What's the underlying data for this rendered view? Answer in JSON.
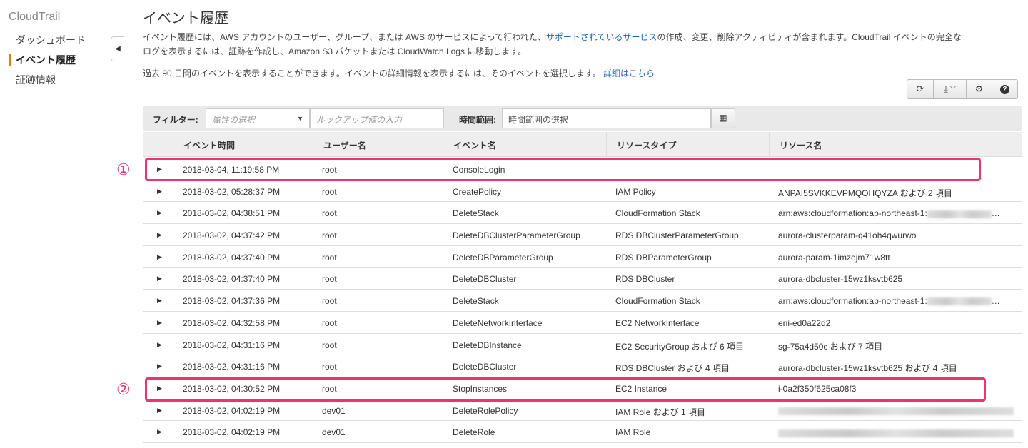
{
  "sidebar": {
    "brand": "CloudTrail",
    "items": [
      {
        "label": "ダッシュボード"
      },
      {
        "label": "イベント履歴"
      },
      {
        "label": "証跡情報"
      }
    ]
  },
  "main": {
    "title": "イベント履歴",
    "desc1_a": "イベント履歴には、AWS アカウントのユーザー、グループ、または AWS のサービスによって行われた、",
    "desc1_link": "サポートされているサービス",
    "desc1_b": "の作成、変更、削除アクティビティが含まれます。CloudTrail イベントの完全な",
    "desc2": "ログを表示するには、証跡を作成し、Amazon S3 バケットまたは CloudWatch Logs に移動します。",
    "desc3": "過去 90 日間のイベントを表示することができます。イベントの詳細情報を表示するには、そのイベントを選択します。",
    "desc3_link": "詳細はこちら"
  },
  "filter": {
    "label": "フィルター:",
    "attr_placeholder": "属性の選択",
    "lookup_placeholder": "ルックアップ値の入力",
    "time_label": "時間範囲:",
    "time_placeholder": "時間範囲の選択"
  },
  "table": {
    "headers": [
      "イベント時間",
      "ユーザー名",
      "イベント名",
      "リソースタイプ",
      "リソース名"
    ],
    "rows": [
      [
        "2018-03-04, 11:19:58 PM",
        "root",
        "ConsoleLogin",
        "",
        ""
      ],
      [
        "2018-03-02, 05:28:37 PM",
        "root",
        "CreatePolicy",
        "IAM Policy",
        "ANPAI5SVKKEVPMQOHQYZA および 2 項目"
      ],
      [
        "2018-03-02, 04:38:51 PM",
        "root",
        "DeleteStack",
        "CloudFormation Stack",
        "arn:aws:cloudformation:ap-northeast-1:"
      ],
      [
        "2018-03-02, 04:37:42 PM",
        "root",
        "DeleteDBClusterParameterGroup",
        "RDS DBClusterParameterGroup",
        "aurora-clusterparam-q41oh4qwurwo"
      ],
      [
        "2018-03-02, 04:37:40 PM",
        "root",
        "DeleteDBParameterGroup",
        "RDS DBParameterGroup",
        "aurora-param-1imzejm71w8tt"
      ],
      [
        "2018-03-02, 04:37:40 PM",
        "root",
        "DeleteDBCluster",
        "RDS DBCluster",
        "aurora-dbcluster-15wz1ksvtb625"
      ],
      [
        "2018-03-02, 04:37:36 PM",
        "root",
        "DeleteStack",
        "CloudFormation Stack",
        "arn:aws:cloudformation:ap-northeast-1:"
      ],
      [
        "2018-03-02, 04:32:58 PM",
        "root",
        "DeleteNetworkInterface",
        "EC2 NetworkInterface",
        "eni-ed0a22d2"
      ],
      [
        "2018-03-02, 04:31:16 PM",
        "root",
        "DeleteDBInstance",
        "EC2 SecurityGroup および 6 項目",
        "sg-75a4d50c および 7 項目"
      ],
      [
        "2018-03-02, 04:31:16 PM",
        "root",
        "DeleteDBCluster",
        "RDS DBCluster および 4 項目",
        "aurora-dbcluster-15wz1ksvtb625 および 4 項目"
      ],
      [
        "2018-03-02, 04:30:52 PM",
        "root",
        "StopInstances",
        "EC2 Instance",
        "i-0a2f350f625ca08f3"
      ],
      [
        "2018-03-02, 04:02:19 PM",
        "dev01",
        "DeleteRolePolicy",
        "IAM Role および 1 項目",
        ""
      ],
      [
        "2018-03-02, 04:02:19 PM",
        "dev01",
        "DeleteRole",
        "IAM Role",
        ""
      ]
    ]
  },
  "annotations": [
    "①",
    "②"
  ],
  "colors": {
    "highlight": "#f0326e",
    "accent": "#e47911",
    "link": "#1e6bb8"
  }
}
